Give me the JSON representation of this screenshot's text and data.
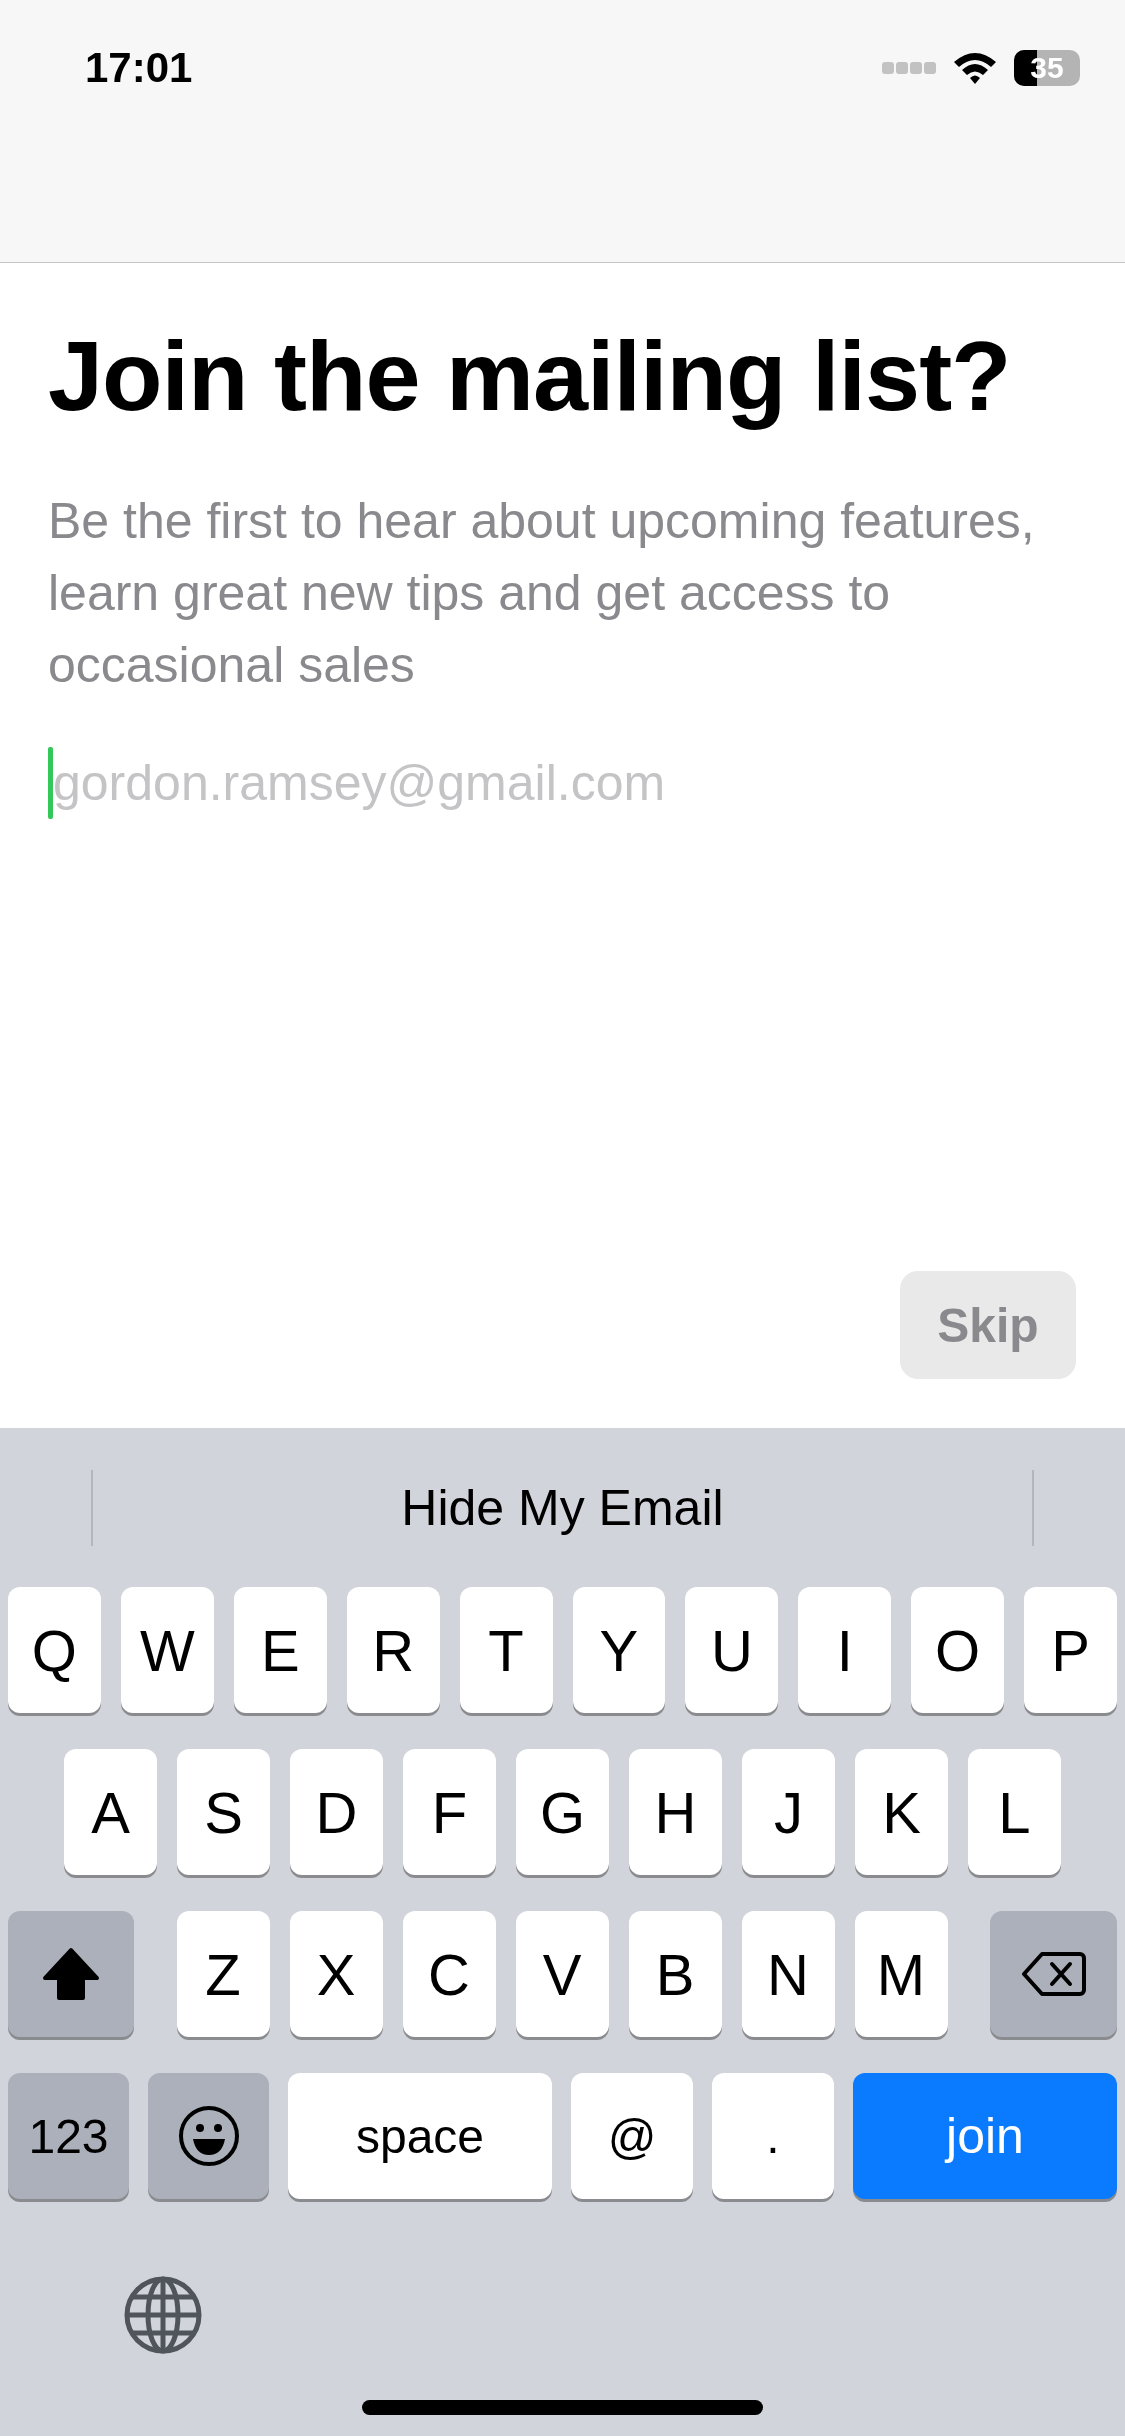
{
  "status_bar": {
    "time": "17:01",
    "battery": "35"
  },
  "title": "Join the mailing list?",
  "subtitle": "Be the first to hear about upcoming features, learn great new tips and get access to occasional sales",
  "email_field": {
    "placeholder": "gordon.ramsey@gmail.com",
    "focused": true
  },
  "skip_button": {
    "label": "Skip",
    "disabled": true
  },
  "keyboard": {
    "suggestions": [
      "Hide My Email"
    ],
    "rows": [
      [
        {
          "kind": "letter",
          "label": "Q"
        },
        {
          "kind": "letter",
          "label": "W"
        },
        {
          "kind": "letter",
          "label": "E"
        },
        {
          "kind": "letter",
          "label": "R"
        },
        {
          "kind": "letter",
          "label": "T"
        },
        {
          "kind": "letter",
          "label": "Y"
        },
        {
          "kind": "letter",
          "label": "U"
        },
        {
          "kind": "letter",
          "label": "I"
        },
        {
          "kind": "letter",
          "label": "O"
        },
        {
          "kind": "letter",
          "label": "P"
        }
      ],
      [
        {
          "kind": "letter",
          "label": "A"
        },
        {
          "kind": "letter",
          "label": "S"
        },
        {
          "kind": "letter",
          "label": "D"
        },
        {
          "kind": "letter",
          "label": "F"
        },
        {
          "kind": "letter",
          "label": "G"
        },
        {
          "kind": "letter",
          "label": "H"
        },
        {
          "kind": "letter",
          "label": "J"
        },
        {
          "kind": "letter",
          "label": "K"
        },
        {
          "kind": "letter",
          "label": "L"
        }
      ],
      [
        {
          "kind": "shift",
          "on": true
        },
        {
          "kind": "letter",
          "label": "Z"
        },
        {
          "kind": "letter",
          "label": "X"
        },
        {
          "kind": "letter",
          "label": "C"
        },
        {
          "kind": "letter",
          "label": "V"
        },
        {
          "kind": "letter",
          "label": "B"
        },
        {
          "kind": "letter",
          "label": "N"
        },
        {
          "kind": "letter",
          "label": "M"
        },
        {
          "kind": "delete"
        }
      ]
    ],
    "bottom_row": [
      {
        "kind": "mode",
        "label": "123"
      },
      {
        "kind": "emoji"
      },
      {
        "kind": "space",
        "label": "space"
      },
      {
        "kind": "char",
        "label": "@"
      },
      {
        "kind": "char",
        "label": "."
      },
      {
        "kind": "return",
        "label": "join"
      }
    ]
  }
}
